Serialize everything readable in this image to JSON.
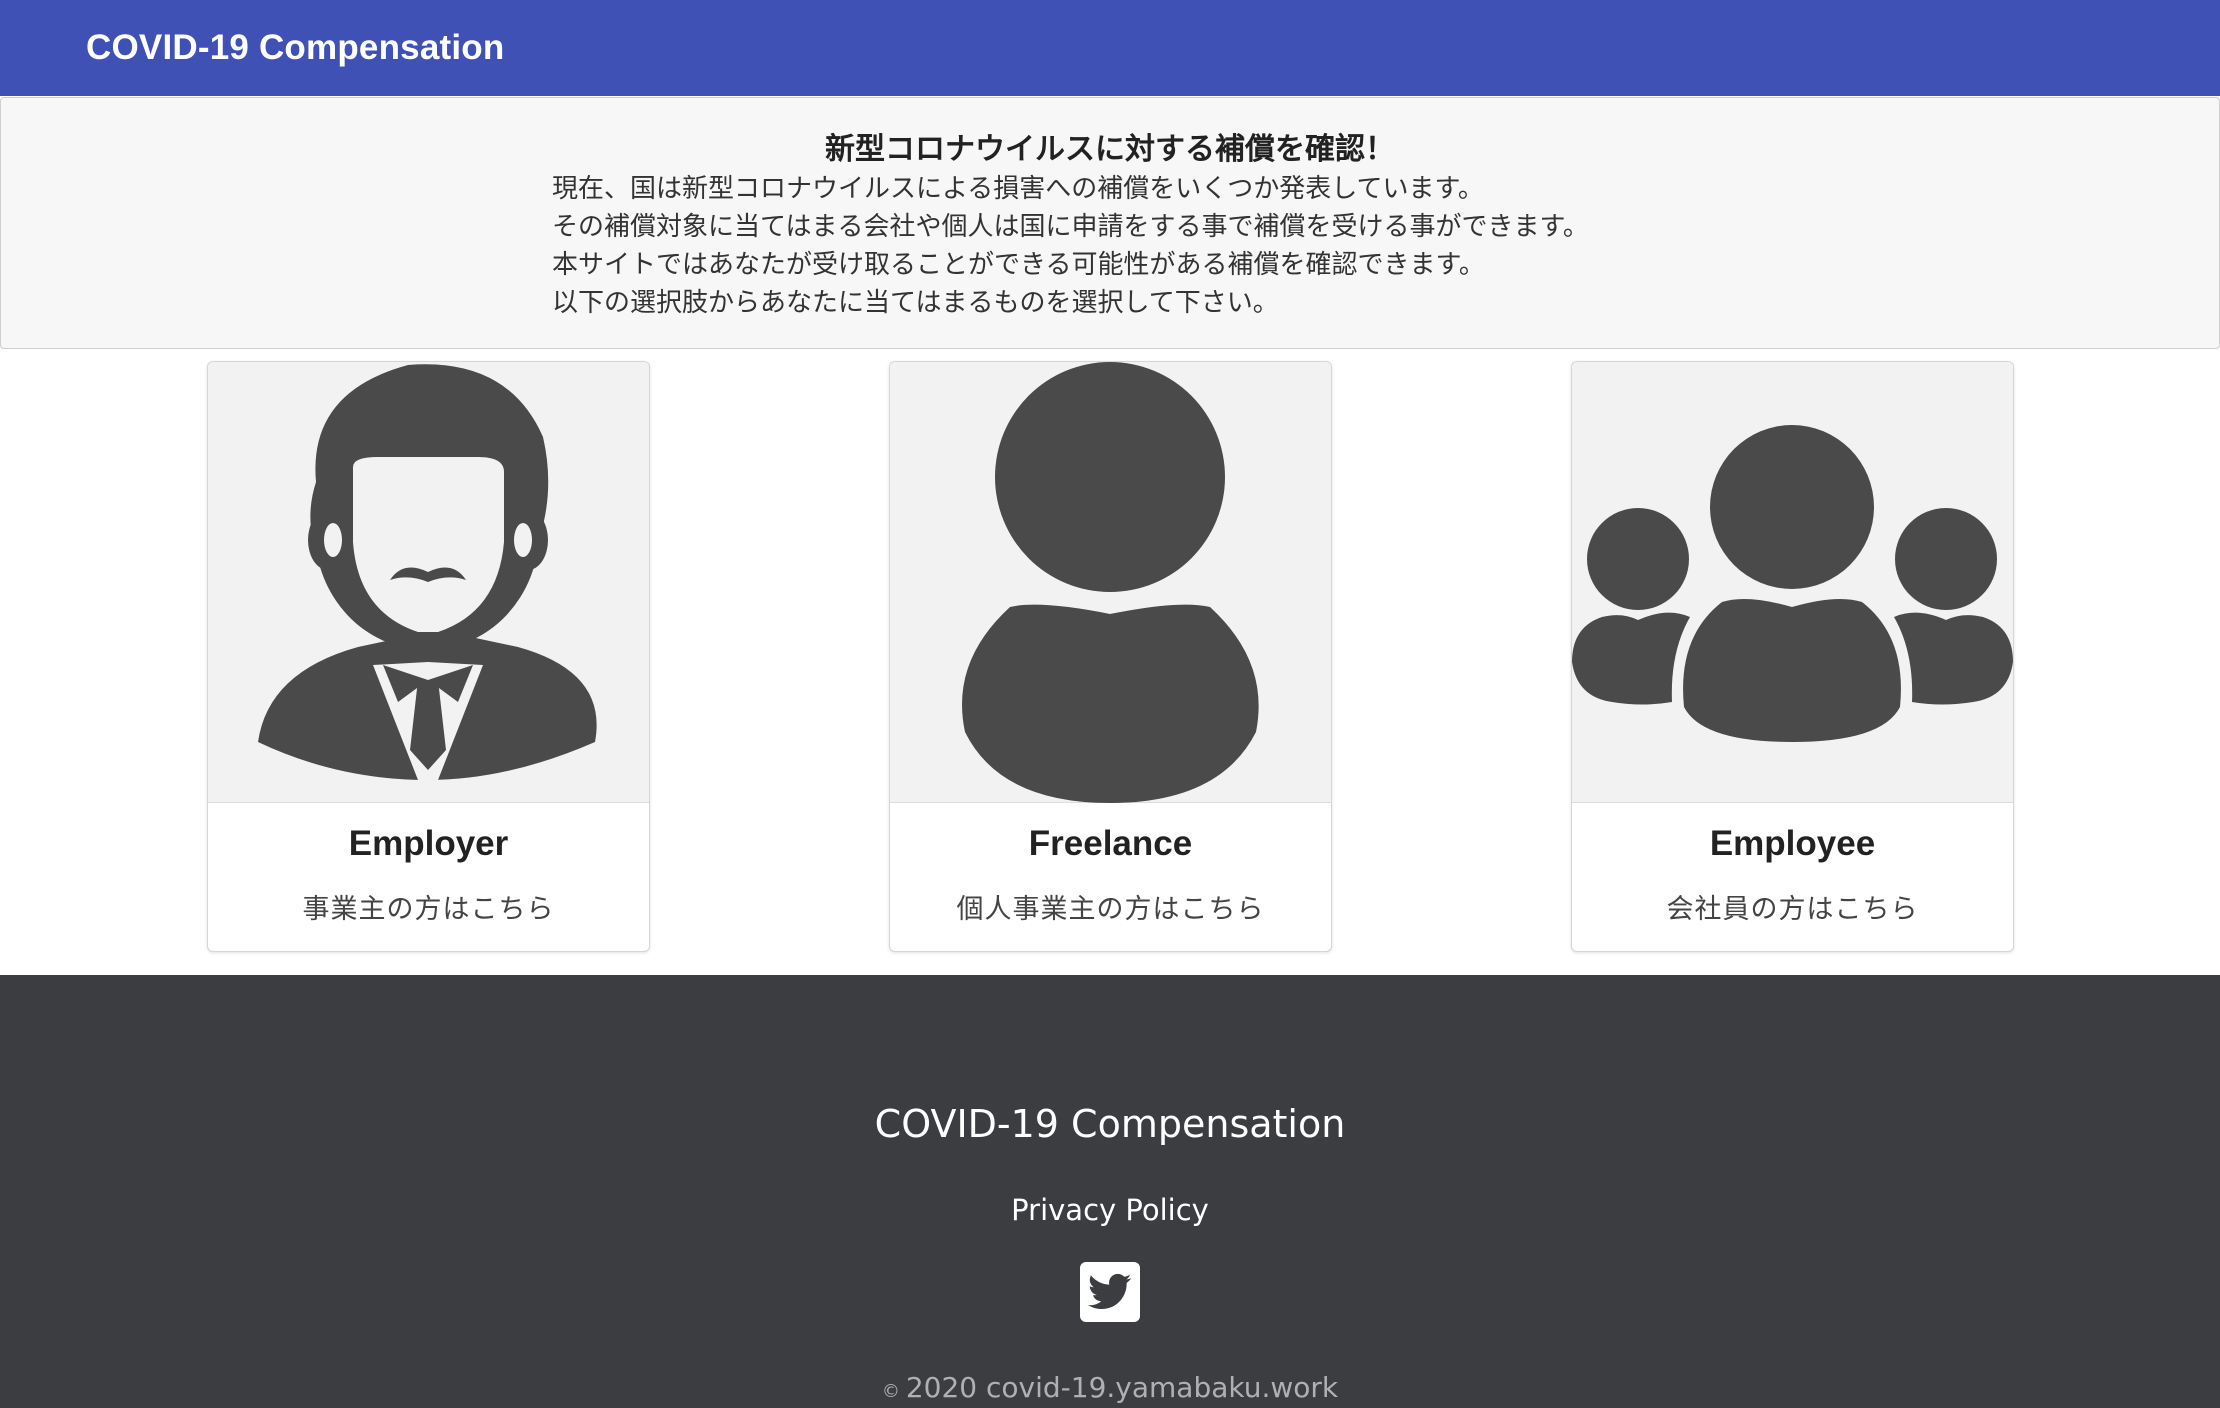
{
  "header": {
    "brand": "COVID-19 Compensation"
  },
  "intro": {
    "title": "新型コロナウイルスに対する補償を確認！",
    "lines": [
      "現在、国は新型コロナウイルスによる損害への補償をいくつか発表しています。",
      "その補償対象に当てはまる会社や個人は国に申請をする事で補償を受ける事ができます。",
      "本サイトではあなたが受け取ることができる可能性がある補償を確認できます。",
      "以下の選択肢からあなたに当てはまるものを選択して下さい。"
    ]
  },
  "cards": [
    {
      "title": "Employer",
      "text": "事業主の方はこちら",
      "icon": "businessman-icon"
    },
    {
      "title": "Freelance",
      "text": "個人事業主の方はこちら",
      "icon": "person-icon"
    },
    {
      "title": "Employee",
      "text": "会社員の方はこちら",
      "icon": "group-icon"
    }
  ],
  "footer": {
    "title": "COVID-19 Compensation",
    "privacy_link": "Privacy Policy",
    "social_icon": "twitter-icon",
    "copyright_symbol": "©",
    "copyright_text": "2020 covid-19.yamabaku.work"
  },
  "colors": {
    "navbar": "#3f51b5",
    "footer": "#3c3d41",
    "icon_fill": "#4a4a4a",
    "card_image_bg": "#f2f2f2"
  }
}
